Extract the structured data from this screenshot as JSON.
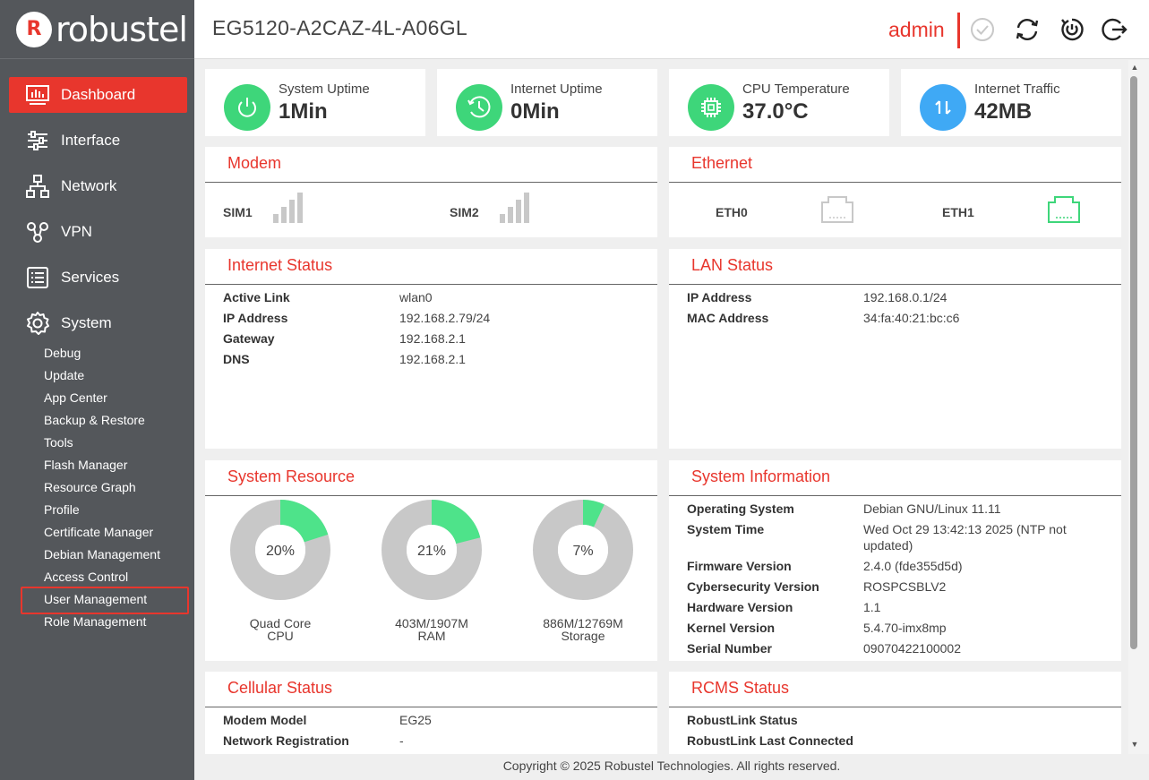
{
  "brand": {
    "logo_text": "robustel"
  },
  "header": {
    "device_name": "EG5120-A2CAZ-4L-A06GL",
    "user": "admin"
  },
  "sidebar": {
    "items": [
      {
        "label": "Dashboard",
        "icon": "dashboard-icon",
        "active": true
      },
      {
        "label": "Interface",
        "icon": "sliders-icon"
      },
      {
        "label": "Network",
        "icon": "network-icon"
      },
      {
        "label": "VPN",
        "icon": "vpn-icon"
      },
      {
        "label": "Services",
        "icon": "services-icon"
      },
      {
        "label": "System",
        "icon": "gear-icon"
      }
    ],
    "system_sub": [
      "Debug",
      "Update",
      "App Center",
      "Backup & Restore",
      "Tools",
      "Flash Manager",
      "Resource Graph",
      "Profile",
      "Certificate Manager",
      "Debian Management",
      "Access Control",
      "User Management",
      "Role Management"
    ],
    "selected_sub": "User Management"
  },
  "stats": [
    {
      "label": "System Uptime",
      "value": "1Min",
      "icon": "power-icon",
      "color": "#3ed67a"
    },
    {
      "label": "Internet Uptime",
      "value": "0Min",
      "icon": "clock-icon",
      "color": "#3ed67a"
    },
    {
      "label": "CPU Temperature",
      "value": "37.0°C",
      "icon": "cpu-icon",
      "color": "#3ed67a"
    },
    {
      "label": "Internet Traffic",
      "value": "42MB",
      "icon": "traffic-icon",
      "color": "#3fa9f5"
    }
  ],
  "modem": {
    "title": "Modem",
    "sims": [
      {
        "label": "SIM1",
        "signal_bars_active": 0
      },
      {
        "label": "SIM2",
        "signal_bars_active": 0
      }
    ]
  },
  "ethernet": {
    "title": "Ethernet",
    "ports": [
      {
        "label": "ETH0",
        "connected": false
      },
      {
        "label": "ETH1",
        "connected": true
      }
    ]
  },
  "internet_status": {
    "title": "Internet Status",
    "rows": [
      {
        "key": "Active Link",
        "value": "wlan0"
      },
      {
        "key": "IP Address",
        "value": "192.168.2.79/24"
      },
      {
        "key": "Gateway",
        "value": "192.168.2.1"
      },
      {
        "key": "DNS",
        "value": "192.168.2.1"
      }
    ]
  },
  "lan_status": {
    "title": "LAN Status",
    "rows": [
      {
        "key": "IP Address",
        "value": "192.168.0.1/24"
      },
      {
        "key": "MAC Address",
        "value": "34:fa:40:21:bc:c6"
      }
    ]
  },
  "system_resource": {
    "title": "System Resource",
    "donuts": [
      {
        "percent": 20,
        "pct_label": "20%",
        "line1": "Quad Core",
        "line2": "CPU"
      },
      {
        "percent": 21,
        "pct_label": "21%",
        "line1": "403M/1907M",
        "line2": "RAM"
      },
      {
        "percent": 7,
        "pct_label": "7%",
        "line1": "886M/12769M",
        "line2": "Storage"
      }
    ],
    "used_color": "#4ee38a",
    "free_color": "#c8c8c8"
  },
  "system_information": {
    "title": "System Information",
    "rows": [
      {
        "key": "Operating System",
        "value": "Debian GNU/Linux 11.11"
      },
      {
        "key": "System Time",
        "value": "Wed Oct 29 13:42:13 2025 (NTP not updated)"
      },
      {
        "key": "Firmware Version",
        "value": "2.4.0 (fde355d5d)"
      },
      {
        "key": "Cybersecurity Version",
        "value": "ROSPCSBLV2"
      },
      {
        "key": "Hardware Version",
        "value": "1.1"
      },
      {
        "key": "Kernel Version",
        "value": "5.4.70-imx8mp"
      },
      {
        "key": "Serial Number",
        "value": "09070422100002"
      }
    ]
  },
  "cellular_status": {
    "title": "Cellular Status",
    "rows": [
      {
        "key": "Modem Model",
        "value": "EG25"
      },
      {
        "key": "Network Registration",
        "value": "-"
      }
    ]
  },
  "rcms_status": {
    "title": "RCMS Status",
    "rows": [
      {
        "key": "RobustLink Status",
        "value": ""
      },
      {
        "key": "RobustLink Last Connected",
        "value": ""
      }
    ]
  },
  "footer": {
    "text": "Copyright © 2025 Robustel Technologies. All rights reserved."
  },
  "colors": {
    "accent": "#e8362d",
    "sidebar": "#54575b",
    "eth_connected": "#3ed67a",
    "eth_disconnected": "#c8c8c8"
  }
}
